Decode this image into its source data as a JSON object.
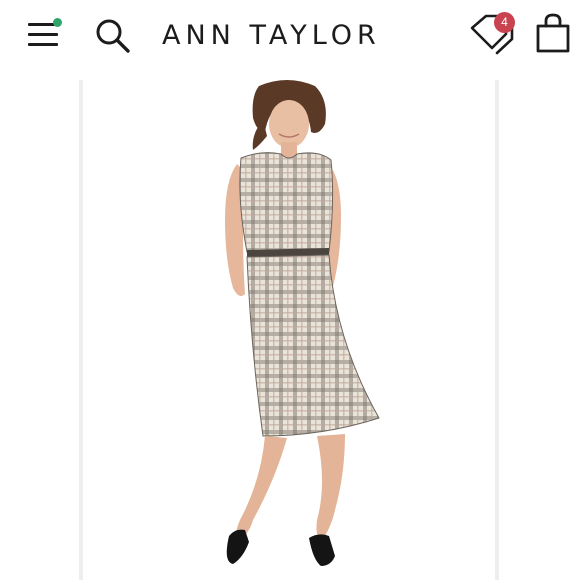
{
  "header": {
    "logo_text": "ANN TAYLOR",
    "menu_icon": "hamburger-menu-icon",
    "search_icon": "search-icon",
    "offers_icon": "price-tags-icon",
    "offers_badge_count": "4",
    "bag_icon": "shopping-bag-icon",
    "notification_dot_color": "#2ea36a",
    "badge_color": "#c8424f"
  },
  "product": {
    "image_icon": "dress-product-photo",
    "dress_pattern": "plaid"
  }
}
